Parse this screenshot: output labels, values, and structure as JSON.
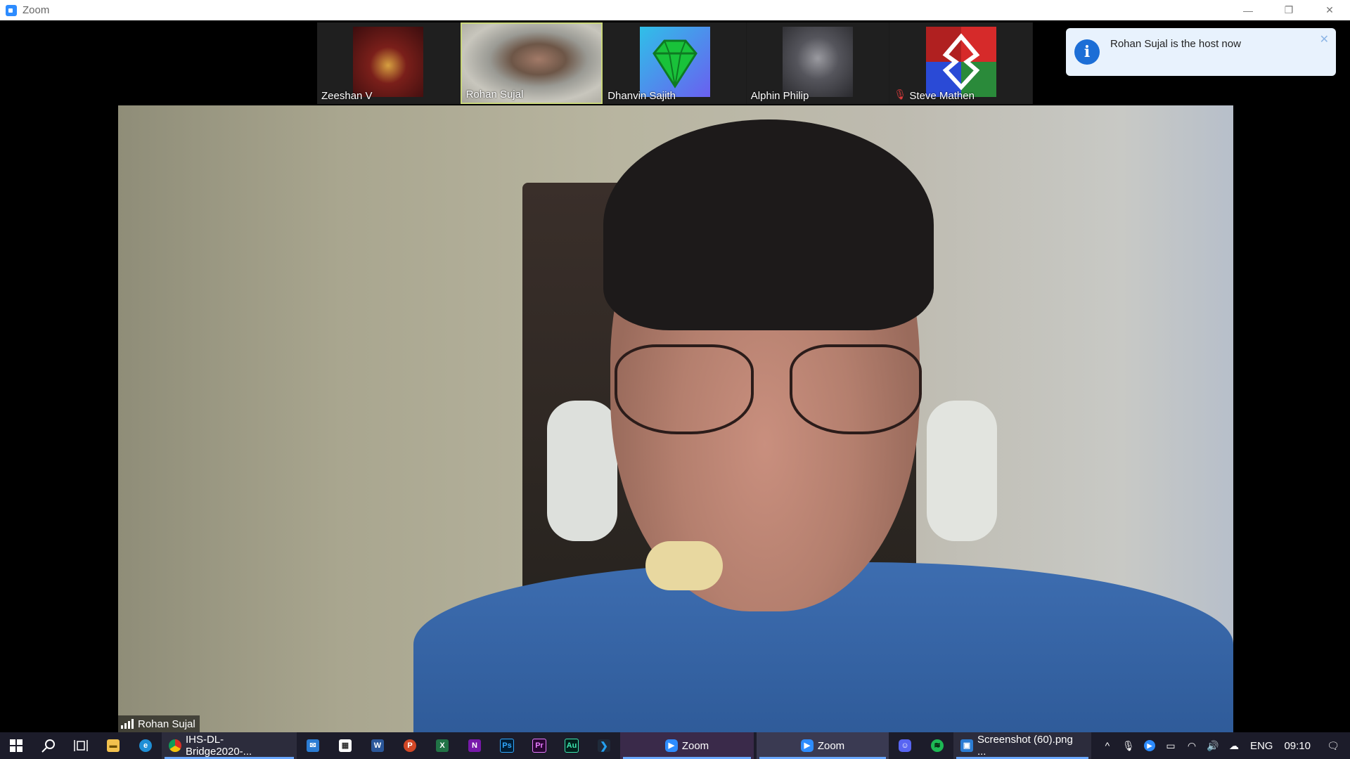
{
  "window": {
    "title": "Zoom",
    "controls": {
      "minimize": "—",
      "restore": "❐",
      "close": "✕"
    }
  },
  "participants": [
    {
      "name": "Zeeshan V",
      "muted": false,
      "active": false
    },
    {
      "name": "Rohan Sujal",
      "muted": false,
      "active": true
    },
    {
      "name": "Dhanvin Sajith",
      "muted": false,
      "active": false
    },
    {
      "name": "Alphin Philip",
      "muted": false,
      "active": false
    },
    {
      "name": "Steve Mathen",
      "muted": true,
      "active": false
    }
  ],
  "notification": {
    "message": "Rohan Sujal is the host now",
    "icon": "i",
    "close": "✕"
  },
  "main_video": {
    "speaker_name": "Rohan Sujal"
  },
  "taskbar": {
    "apps": [
      {
        "label": "IHS-DL-Bridge2020-..."
      },
      {
        "label": "Zoom"
      },
      {
        "label": "Zoom"
      },
      {
        "label": "Screenshot (60).png ..."
      }
    ],
    "icon_letters": {
      "word": "W",
      "powerpoint": "P",
      "excel": "X",
      "onenote": "N",
      "photoshop": "Ps",
      "premiere": "Pr",
      "audition": "Au"
    },
    "language": "ENG",
    "time": "09:10"
  }
}
